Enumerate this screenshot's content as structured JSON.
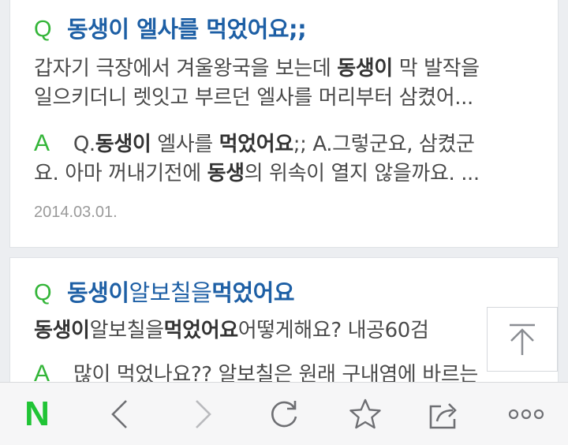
{
  "results": [
    {
      "q_mark": "Q",
      "title_parts": [
        "동생이",
        " 엘사를 ",
        "먹었어요",
        ";;"
      ],
      "snippet_line1": [
        "갑자기 극장에서 겨울왕국을 보는데 ",
        "동생이",
        " 막 발작을"
      ],
      "snippet_line2": "일으키더니 렛잇고 부르던 엘사를 머리부터 삼켰어...",
      "a_mark": "A",
      "answer_line1": [
        " Q.",
        "동생이",
        " 엘사를 ",
        "먹었어요",
        ";; A.그렇군요, 삼켰군"
      ],
      "answer_line2": [
        "요. 아마 꺼내기전에 ",
        "동생",
        "의 위속이 열지 않을까요. ..."
      ],
      "date": "2014.03.01."
    },
    {
      "q_mark": "Q",
      "title_parts": [
        "동생이",
        "알보칠을",
        "먹었어요"
      ],
      "snippet_line1": [
        "동생이",
        "알보칠을",
        "먹었어요",
        "어떻게해요? 내공60검"
      ],
      "a_mark": "A",
      "answer_line1": " 많이 먹었나요?? 알보칠은 원래 구내염에 바르는"
    }
  ],
  "toolbar": {
    "home_logo": "N",
    "back_icon": "chevron-left",
    "forward_icon": "chevron-right",
    "refresh_icon": "refresh",
    "bookmark_icon": "star",
    "share_icon": "share",
    "more_icon": "more"
  },
  "colors": {
    "accent_green": "#34b539",
    "title_blue": "#1d5fa5",
    "naver_green": "#20c435"
  }
}
